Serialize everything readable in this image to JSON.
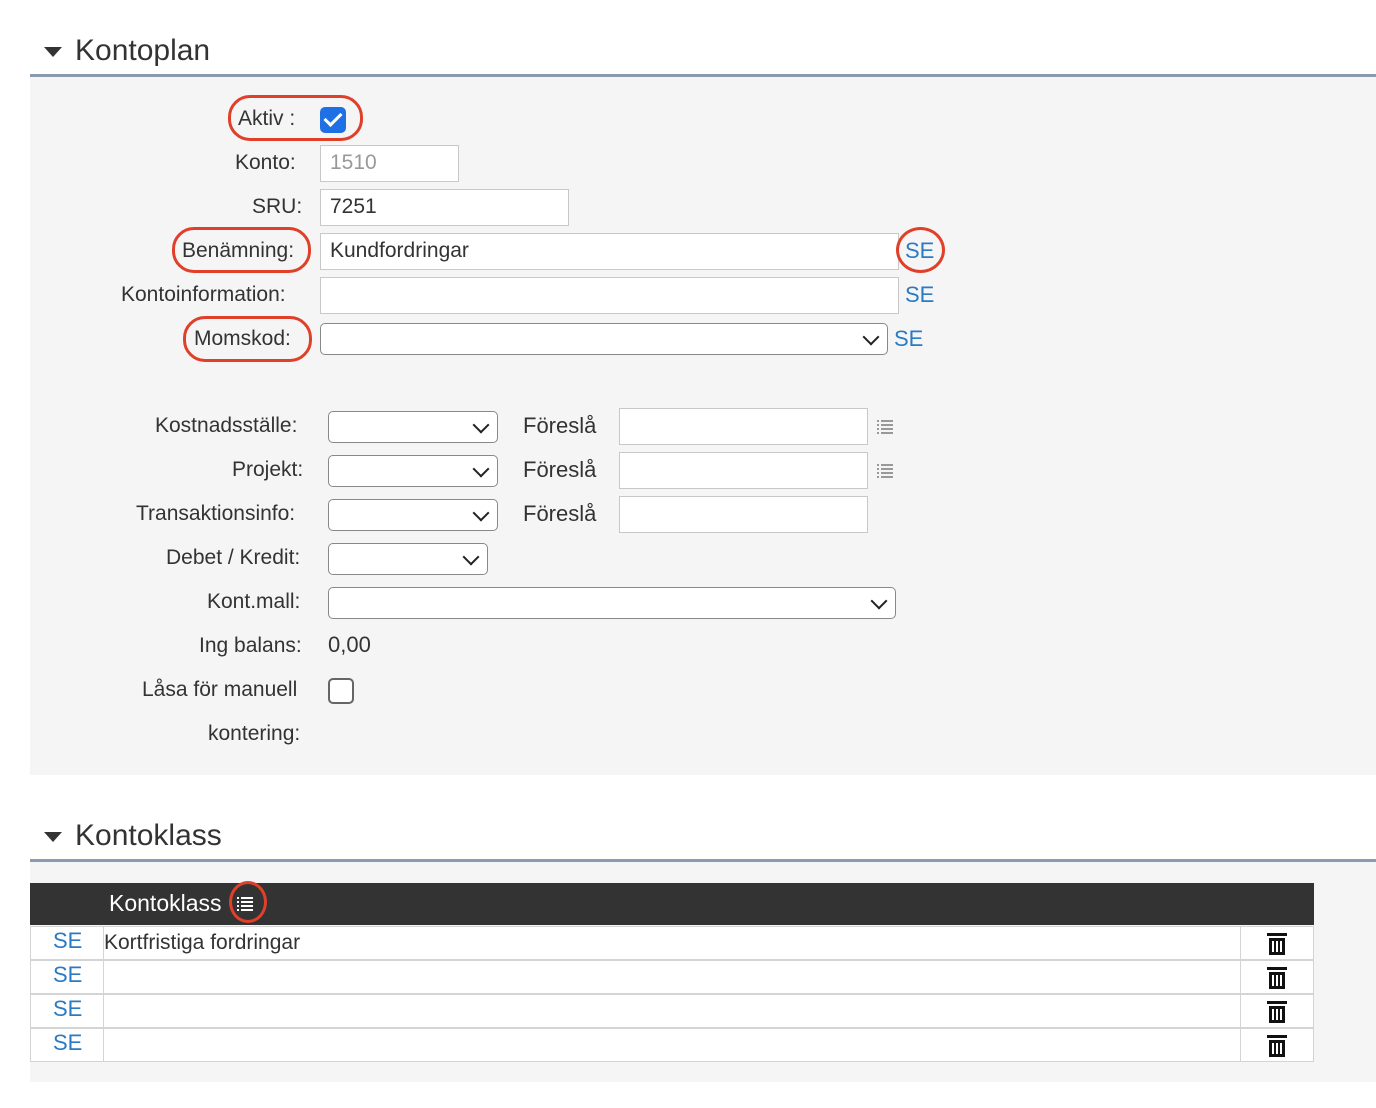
{
  "kontoplan": {
    "title": "Kontoplan",
    "fields": {
      "aktiv_label": "Aktiv :",
      "aktiv_checked": true,
      "konto_label": "Konto:",
      "konto_value": "1510",
      "sru_label": "SRU:",
      "sru_value": "7251",
      "benamning_label": "Benämning:",
      "benamning_value": "Kundfordringar",
      "kontoinfo_label": "Kontoinformation:",
      "kontoinfo_value": "",
      "momskod_label": "Momskod:",
      "momskod_value": "",
      "lang_link": "SE"
    },
    "dims": {
      "kostnadsstalle_label": "Kostnadsställe:",
      "projekt_label": "Projekt:",
      "transaktionsinfo_label": "Transaktionsinfo:",
      "foresla_label": "Föreslå",
      "debet_kredit_label": "Debet / Kredit:",
      "kontmall_label": "Kont.mall:",
      "ing_balans_label": "Ing balans:",
      "ing_balans_value": "0,00",
      "lasa_label_line1": "Låsa för manuell",
      "lasa_label_line2": "kontering:",
      "lasa_checked": false
    }
  },
  "kontoklass": {
    "title": "Kontoklass",
    "column_header": "Kontoklass",
    "rows": [
      {
        "lang": "SE",
        "value": "Kortfristiga fordringar"
      },
      {
        "lang": "SE",
        "value": ""
      },
      {
        "lang": "SE",
        "value": ""
      },
      {
        "lang": "SE",
        "value": ""
      }
    ]
  },
  "colors": {
    "accent": "#2a7bc4",
    "highlight": "#e0402a",
    "header_dark": "#333333"
  },
  "icons": [
    "caret-down-icon",
    "checkbox-icon",
    "chevron-down-icon",
    "list-icon",
    "trash-icon"
  ]
}
